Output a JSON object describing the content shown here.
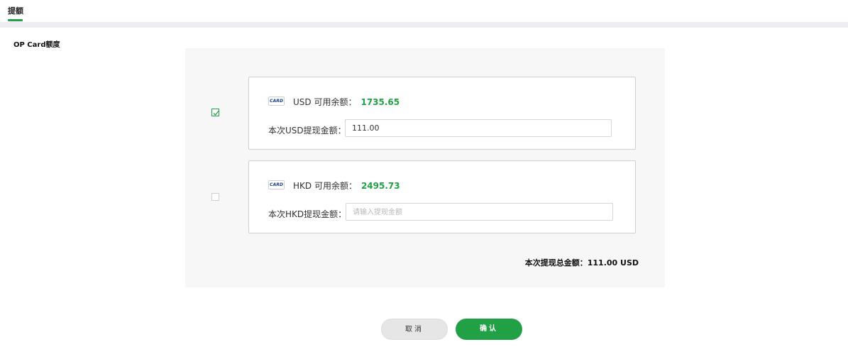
{
  "tabs": [
    {
      "label": "提额",
      "active": true
    }
  ],
  "section_title": "OP Card额度",
  "accent_color": "#22a045",
  "cards": [
    {
      "checked": true,
      "logo_text": "CARD",
      "currency_label": "USD 可用余额：",
      "balance": "1735.65",
      "amount_label": "本次USD提现金额：",
      "amount_value": "111.00",
      "amount_placeholder": ""
    },
    {
      "checked": false,
      "logo_text": "CARD",
      "currency_label": "HKD 可用余额：",
      "balance": "2495.73",
      "amount_label": "本次HKD提现金额：",
      "amount_value": "",
      "amount_placeholder": "请输入提现金额"
    }
  ],
  "total_text": "本次提现总金额：111.00 USD",
  "buttons": {
    "cancel": "取消",
    "confirm": "确认"
  }
}
